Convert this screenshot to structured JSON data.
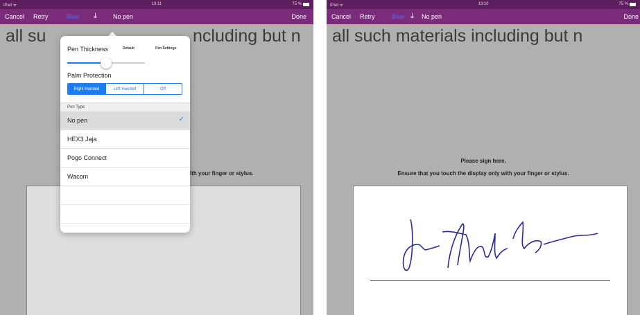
{
  "left": {
    "status": {
      "carrier": "iPad ᯤ",
      "time": "13:11",
      "battery": "75 %"
    },
    "toolbar": {
      "cancel": "Cancel",
      "retry": "Retry",
      "color": "Blue",
      "download_icon": "download-arrow-icon",
      "pen": "No pen",
      "done": "Done"
    },
    "doc_text_a": "all su",
    "doc_text_b": "ncluding but n",
    "sign_fragment": "ith your finger or stylus.",
    "popover": {
      "pen_thickness_label": "Pen Thickness",
      "default_link": "Default",
      "pen_settings_link": "Pen Settings",
      "thickness_value": 0.5,
      "palm_protection_label": "Palm Protection",
      "palm_options": [
        "Right Handed",
        "Left Handed",
        "Off"
      ],
      "palm_selected": "Right Handed",
      "pen_type_header": "Pen Type",
      "pen_types": [
        {
          "label": "No pen",
          "selected": true
        },
        {
          "label": "HEX3 Jaja",
          "selected": false
        },
        {
          "label": "Pogo Connect",
          "selected": false
        },
        {
          "label": "Wacom",
          "selected": false
        }
      ],
      "check_icon": "checkmark-icon"
    }
  },
  "right": {
    "status": {
      "carrier": "iPad ᯤ",
      "time": "13:10",
      "battery": "75 %"
    },
    "toolbar": {
      "cancel": "Cancel",
      "retry": "Retry",
      "color": "Blue",
      "download_icon": "download-arrow-icon",
      "pen": "No pen",
      "done": "Done"
    },
    "doc_text": "all such materials including but n",
    "sign_title": "Please sign here.",
    "sign_instructions": "Ensure that you touch the display only with your finger or stylus."
  },
  "colors": {
    "toolbar": "#7a2c7a",
    "status_bar": "#5c1e5c",
    "accent": "#1e7cf2",
    "signature_ink": "#2a2aa0"
  }
}
